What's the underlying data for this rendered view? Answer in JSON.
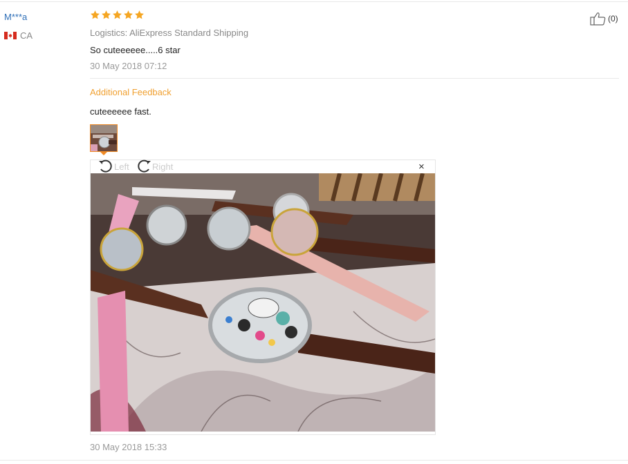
{
  "review": {
    "user": "M***a",
    "country": "CA",
    "rating": 5,
    "logistics": "Logistics: AliExpress Standard Shipping",
    "text": "So cuteeeeee.....6 star",
    "date": "30 May 2018 07:12",
    "helpful_count": "(0)"
  },
  "additional": {
    "title": "Additional Feedback",
    "text": "cuteeeeee fast.",
    "date": "30 May 2018 15:33"
  },
  "viewer": {
    "rotate_left_label": "Left",
    "rotate_right_label": "Right",
    "close_label": "×"
  },
  "colors": {
    "star": "#f5a623",
    "username": "#2f6fb7",
    "accent": "#f0a030",
    "muted": "#888888"
  }
}
